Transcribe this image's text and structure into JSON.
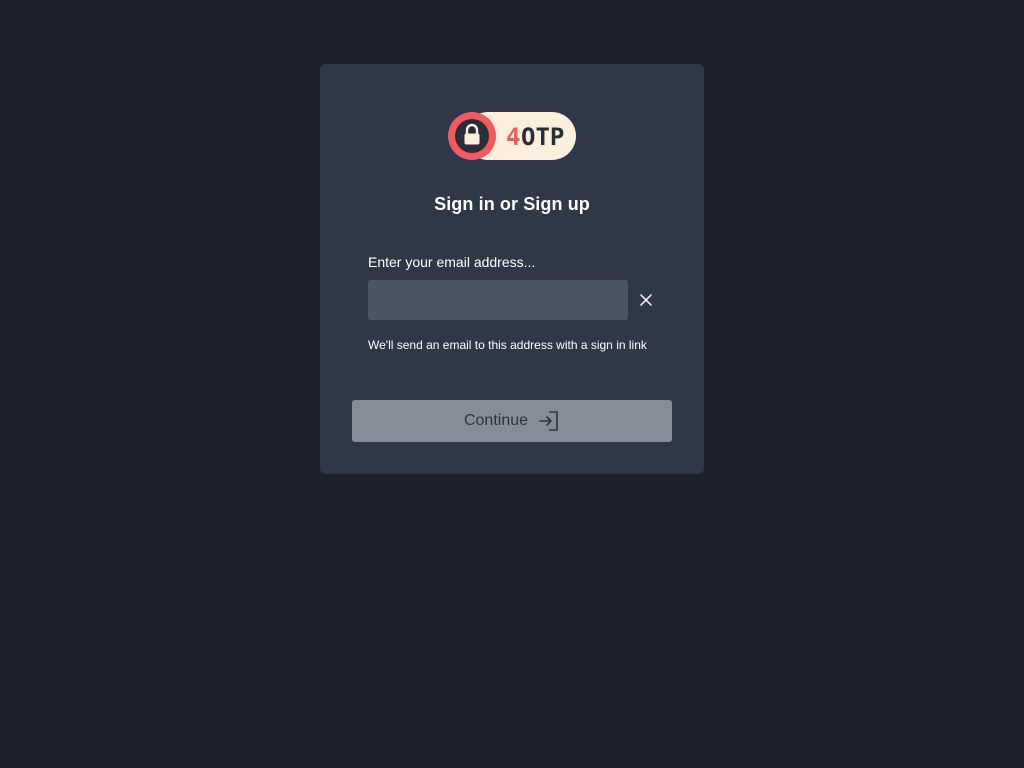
{
  "logo": {
    "text_accent": "4",
    "text_main": "OTP",
    "colors": {
      "red": "#f25a5f",
      "cream": "#fbeedb",
      "dark": "#2a2e38"
    }
  },
  "title": "Sign in or Sign up",
  "form": {
    "email_label": "Enter your email address...",
    "email_value": "",
    "email_placeholder": "",
    "clear_icon": "close-icon",
    "hint": "We'll send an email to this address with a sign in link"
  },
  "continue_button": {
    "label": "Continue",
    "icon": "sign-in-icon"
  },
  "colors": {
    "page_bg": "#1d212b",
    "card_bg": "#2f3848",
    "input_bg": "#4a5566",
    "button_bg": "#858d98"
  }
}
